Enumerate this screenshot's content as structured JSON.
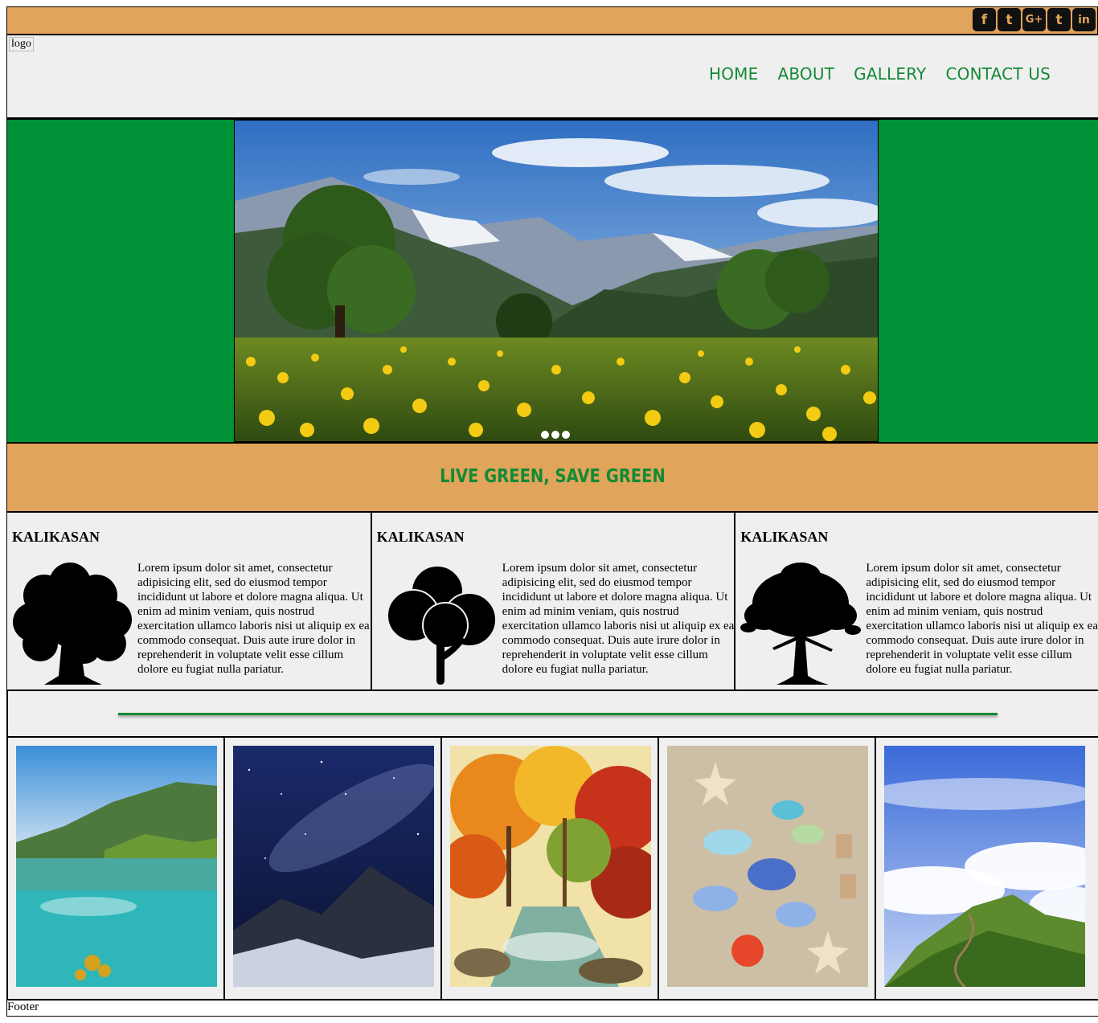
{
  "social": {
    "icons": [
      "facebook-icon",
      "twitter-icon",
      "google-plus-icon",
      "tumblr-icon",
      "linkedin-icon"
    ],
    "glyphs": [
      "f",
      "t",
      "G+",
      "t",
      "in"
    ]
  },
  "header": {
    "logo_alt": "logo",
    "nav": [
      "HOME",
      "ABOUT",
      "GALLERY",
      "CONTACT US"
    ]
  },
  "hero": {
    "dots": 3
  },
  "slogan": {
    "text": "LIVE GREEN, SAVE GREEN"
  },
  "features": [
    {
      "title": "KALIKASAN",
      "icon": "tree-icon",
      "text": "Lorem ipsum dolor sit amet, consectetur adipisicing elit, sed do eiusmod tempor incididunt ut labore et dolore magna aliqua. Ut enim ad minim veniam, quis nostrud exercitation ullamco laboris nisi ut aliquip ex ea commodo consequat. Duis aute irure dolor in reprehenderit in voluptate velit esse cillum dolore eu fugiat nulla pariatur."
    },
    {
      "title": "KALIKASAN",
      "icon": "round-tree-icon",
      "text": "Lorem ipsum dolor sit amet, consectetur adipisicing elit, sed do eiusmod tempor incididunt ut labore et dolore magna aliqua. Ut enim ad minim veniam, quis nostrud exercitation ullamco laboris nisi ut aliquip ex ea commodo consequat. Duis aute irure dolor in reprehenderit in voluptate velit esse cillum dolore eu fugiat nulla pariatur."
    },
    {
      "title": "KALIKASAN",
      "icon": "oak-tree-icon",
      "text": "Lorem ipsum dolor sit amet, consectetur adipisicing elit, sed do eiusmod tempor incididunt ut labore et dolore magna aliqua. Ut enim ad minim veniam, quis nostrud exercitation ullamco laboris nisi ut aliquip ex ea commodo consequat. Duis aute irure dolor in reprehenderit in voluptate velit esse cillum dolore eu fugiat nulla pariatur."
    }
  ],
  "footer": {
    "text": "Footer"
  },
  "colors": {
    "tan": "#e0a45a",
    "green": "#009236",
    "text_green": "#138a36",
    "panel": "#efefef"
  }
}
